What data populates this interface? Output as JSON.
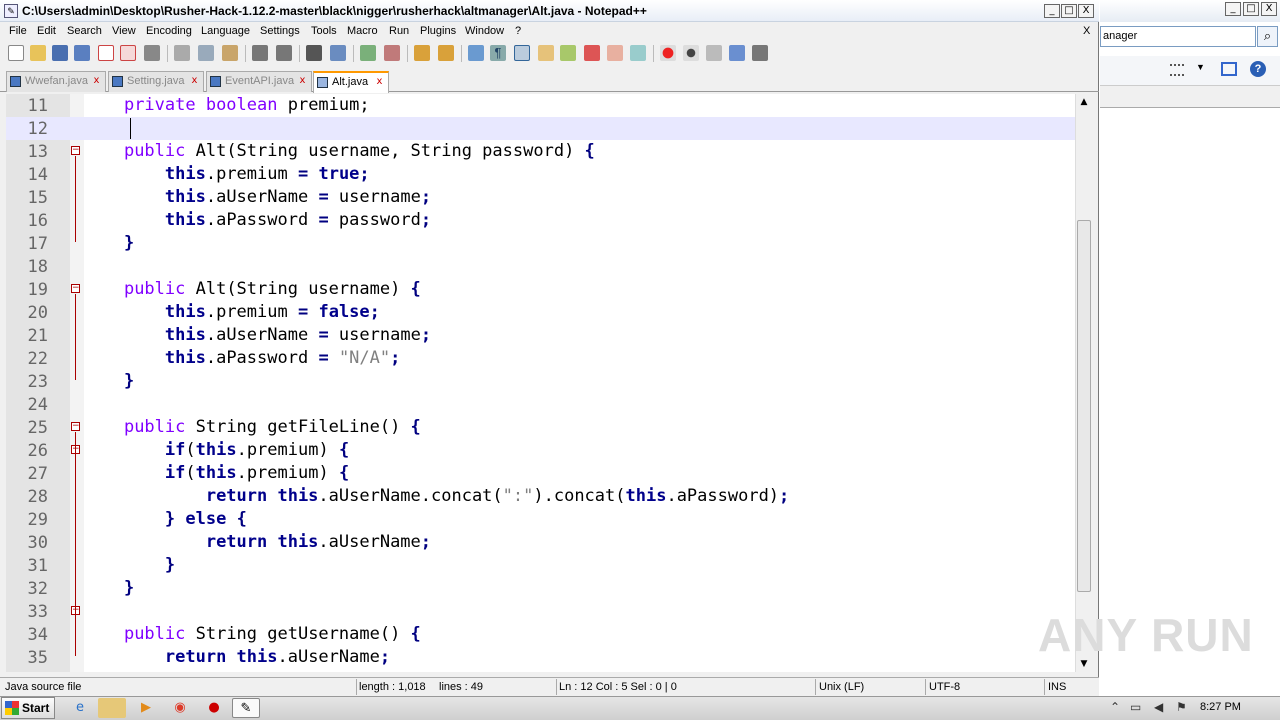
{
  "window": {
    "title": "C:\\Users\\admin\\Desktop\\Rusher-Hack-1.12.2-master\\black\\nigger\\rusherhack\\altmanager\\Alt.java - Notepad++",
    "minimize": "_",
    "maximize": "□",
    "close": "X",
    "doc_close": "X"
  },
  "menu": [
    "File",
    "Edit",
    "Search",
    "View",
    "Encoding",
    "Language",
    "Settings",
    "Tools",
    "Macro",
    "Run",
    "Plugins",
    "Window",
    "?"
  ],
  "tabs": [
    {
      "label": "Wwefan.java",
      "active": false
    },
    {
      "label": "Setting.java",
      "active": false
    },
    {
      "label": "EventAPI.java",
      "active": false
    },
    {
      "label": "Alt.java",
      "active": true
    }
  ],
  "tab_close": "x",
  "code_lines": [
    {
      "n": "11",
      "fold": "",
      "t": [
        [
          "    ",
          ""
        ],
        [
          "private boolean",
          "k1"
        ],
        [
          " premium;",
          ""
        ]
      ]
    },
    {
      "n": "12",
      "fold": "",
      "cur": true,
      "t": [
        [
          "    ",
          ""
        ]
      ]
    },
    {
      "n": "13",
      "fold": "−",
      "t": [
        [
          "    ",
          ""
        ],
        [
          "public",
          "k1"
        ],
        [
          " Alt(String username, String password) ",
          ""
        ],
        [
          "{",
          "op"
        ]
      ]
    },
    {
      "n": "14",
      "fold": "",
      "t": [
        [
          "        ",
          ""
        ],
        [
          "this",
          "k2"
        ],
        [
          ".premium ",
          ""
        ],
        [
          "=",
          "op"
        ],
        [
          " ",
          ""
        ],
        [
          "true",
          "k2"
        ],
        [
          ";",
          "op"
        ]
      ]
    },
    {
      "n": "15",
      "fold": "",
      "t": [
        [
          "        ",
          ""
        ],
        [
          "this",
          "k2"
        ],
        [
          ".aUserName ",
          ""
        ],
        [
          "=",
          "op"
        ],
        [
          " username",
          ""
        ],
        [
          ";",
          "op"
        ]
      ]
    },
    {
      "n": "16",
      "fold": "",
      "t": [
        [
          "        ",
          ""
        ],
        [
          "this",
          "k2"
        ],
        [
          ".aPassword ",
          ""
        ],
        [
          "=",
          "op"
        ],
        [
          " password",
          ""
        ],
        [
          ";",
          "op"
        ]
      ]
    },
    {
      "n": "17",
      "fold": "",
      "t": [
        [
          "    ",
          ""
        ],
        [
          "}",
          "op"
        ]
      ]
    },
    {
      "n": "18",
      "fold": "",
      "t": [
        [
          "",
          ""
        ]
      ]
    },
    {
      "n": "19",
      "fold": "−",
      "t": [
        [
          "    ",
          ""
        ],
        [
          "public",
          "k1"
        ],
        [
          " Alt(String username) ",
          ""
        ],
        [
          "{",
          "op"
        ]
      ]
    },
    {
      "n": "20",
      "fold": "",
      "t": [
        [
          "        ",
          ""
        ],
        [
          "this",
          "k2"
        ],
        [
          ".premium ",
          ""
        ],
        [
          "=",
          "op"
        ],
        [
          " ",
          ""
        ],
        [
          "false",
          "k2"
        ],
        [
          ";",
          "op"
        ]
      ]
    },
    {
      "n": "21",
      "fold": "",
      "t": [
        [
          "        ",
          ""
        ],
        [
          "this",
          "k2"
        ],
        [
          ".aUserName ",
          ""
        ],
        [
          "=",
          "op"
        ],
        [
          " username",
          ""
        ],
        [
          ";",
          "op"
        ]
      ]
    },
    {
      "n": "22",
      "fold": "",
      "t": [
        [
          "        ",
          ""
        ],
        [
          "this",
          "k2"
        ],
        [
          ".aPassword ",
          ""
        ],
        [
          "=",
          "op"
        ],
        [
          " ",
          ""
        ],
        [
          "\"N/A\"",
          "str"
        ],
        [
          ";",
          "op"
        ]
      ]
    },
    {
      "n": "23",
      "fold": "",
      "t": [
        [
          "    ",
          ""
        ],
        [
          "}",
          "op"
        ]
      ]
    },
    {
      "n": "24",
      "fold": "",
      "t": [
        [
          "",
          ""
        ]
      ]
    },
    {
      "n": "25",
      "fold": "−",
      "t": [
        [
          "    ",
          ""
        ],
        [
          "public",
          "k1"
        ],
        [
          " String getFileLine() ",
          ""
        ],
        [
          "{",
          "op"
        ]
      ]
    },
    {
      "n": "26",
      "fold": "−",
      "t": [
        [
          "        ",
          ""
        ],
        [
          "if",
          "k2"
        ],
        [
          "(",
          ""
        ],
        [
          "this",
          "k2"
        ],
        [
          ".premium) ",
          ""
        ],
        [
          "{",
          "op"
        ]
      ]
    },
    {
      "n": "27",
      "fold": "",
      "t": [
        [
          "        ",
          ""
        ],
        [
          "if",
          "k2"
        ],
        [
          "(",
          ""
        ],
        [
          "this",
          "k2"
        ],
        [
          ".premium) ",
          ""
        ],
        [
          "{",
          "op"
        ]
      ]
    },
    {
      "n": "28",
      "fold": "",
      "t": [
        [
          "            ",
          ""
        ],
        [
          "return this",
          "k2"
        ],
        [
          ".aUserName.concat(",
          ""
        ],
        [
          "\":\"",
          "str"
        ],
        [
          ").concat(",
          ""
        ],
        [
          "this",
          "k2"
        ],
        [
          ".aPassword)",
          ""
        ],
        [
          ";",
          "op"
        ]
      ]
    },
    {
      "n": "29",
      "fold": "",
      "t": [
        [
          "        ",
          ""
        ],
        [
          "}",
          "op"
        ],
        [
          " ",
          ""
        ],
        [
          "else",
          "k2"
        ],
        [
          " ",
          ""
        ],
        [
          "{",
          "op"
        ]
      ]
    },
    {
      "n": "30",
      "fold": "",
      "t": [
        [
          "            ",
          ""
        ],
        [
          "return this",
          "k2"
        ],
        [
          ".aUserName",
          ""
        ],
        [
          ";",
          "op"
        ]
      ]
    },
    {
      "n": "31",
      "fold": "",
      "t": [
        [
          "        ",
          ""
        ],
        [
          "}",
          "op"
        ]
      ]
    },
    {
      "n": "32",
      "fold": "",
      "t": [
        [
          "    ",
          ""
        ],
        [
          "}",
          "op"
        ]
      ]
    },
    {
      "n": "33",
      "fold": "−",
      "t": [
        [
          "",
          ""
        ]
      ]
    },
    {
      "n": "34",
      "fold": "",
      "t": [
        [
          "    ",
          ""
        ],
        [
          "public",
          "k1"
        ],
        [
          " String getUsername() ",
          ""
        ],
        [
          "{",
          "op"
        ]
      ]
    },
    {
      "n": "35",
      "fold": "",
      "t": [
        [
          "        ",
          ""
        ],
        [
          "return this",
          "k2"
        ],
        [
          ".aUserName",
          ""
        ],
        [
          ";",
          "op"
        ]
      ]
    }
  ],
  "status": {
    "lang": "Java source file",
    "length": "length : 1,018",
    "lines": "lines : 49",
    "pos": "Ln : 12    Col : 5    Sel : 0 | 0",
    "eol": "Unix (LF)",
    "enc": "UTF-8",
    "mode": "INS"
  },
  "right_pane": {
    "search_value": "anager",
    "search_icon": "magnifier-icon"
  },
  "taskbar": {
    "start": "Start",
    "clock": "8:27 PM"
  },
  "watermark": "ANY RUN",
  "colors": {
    "keyword": "#8000ff",
    "builtin": "#00008b",
    "operator": "#000080",
    "string": "#808080",
    "current_line": "#e8e8ff"
  }
}
